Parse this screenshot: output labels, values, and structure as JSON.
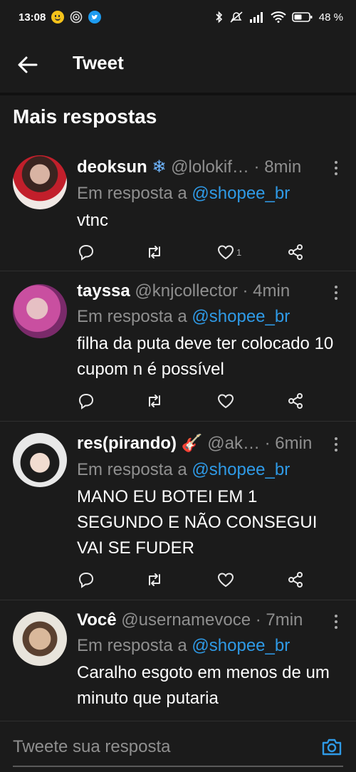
{
  "status_bar": {
    "time": "13:08",
    "battery": "48"
  },
  "header": {
    "title": "Tweet"
  },
  "section": {
    "title": "Mais respostas"
  },
  "colors": {
    "background": "#1b1b1b",
    "link": "#2f9ae6",
    "muted": "#8f8f8f"
  },
  "tweets": [
    {
      "name": "deoksun",
      "meta": "@lolokif… · 8min",
      "reply_prefix": "Em resposta a",
      "reply_handle": "@shopee_br",
      "text": "vtnc",
      "likes": "1"
    },
    {
      "name": "tayssa",
      "meta": "@knjcollector · 4min",
      "reply_prefix": "Em resposta a",
      "reply_handle": "@shopee_br",
      "text": "filha da puta deve ter colocado 10 cupom n é possível",
      "likes": ""
    },
    {
      "name": "res(pirando)",
      "meta": "@ak… · 6min",
      "reply_prefix": "Em resposta a",
      "reply_handle": "@shopee_br",
      "text": "MANO EU BOTEI EM 1 SEGUNDO E NÃO CONSEGUI VAI SE FUDER",
      "likes": ""
    },
    {
      "name": "Você",
      "meta": "@usernamevoce · 7min",
      "reply_prefix": "Em resposta a",
      "reply_handle": "@shopee_br",
      "text": "Caralho esgoto em menos de um minuto que putaria",
      "likes": ""
    }
  ],
  "compose": {
    "placeholder": "Tweete sua resposta"
  }
}
